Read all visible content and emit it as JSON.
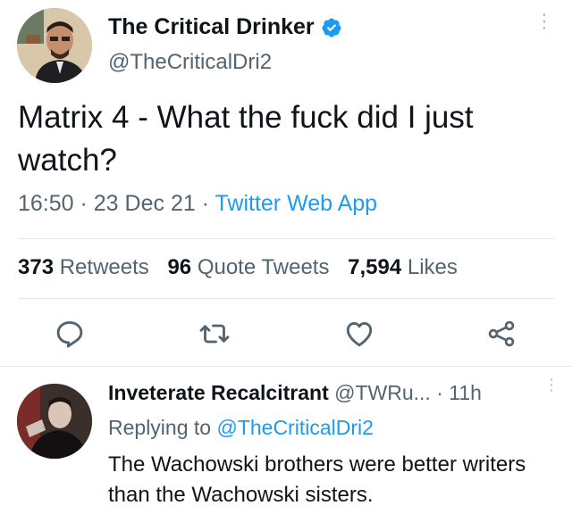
{
  "tweet": {
    "author": {
      "display_name": "The Critical Drinker",
      "handle": "@TheCriticalDri2",
      "verified": true
    },
    "text": "Matrix 4 - What the fuck did I just watch?",
    "time": "16:50",
    "separator1": " · ",
    "date": "23 Dec 21",
    "separator2": " · ",
    "source": "Twitter Web App",
    "stats": [
      {
        "count": "373",
        "label": "Retweets"
      },
      {
        "count": "96",
        "label": "Quote Tweets"
      },
      {
        "count": "7,594",
        "label": "Likes"
      }
    ],
    "actions": [
      "reply-icon",
      "retweet-icon",
      "like-icon",
      "share-icon"
    ]
  },
  "reply": {
    "display_name": "Inveterate Recalcitrant",
    "handle": "@TWRu...",
    "separator": " · ",
    "time": "11h",
    "replying_prefix": "Replying to ",
    "replying_to": "@TheCriticalDri2",
    "text": "The Wachowski brothers were better writers than the Wachowski sisters."
  },
  "colors": {
    "accent": "#1d9bf0",
    "secondary_text": "#536471",
    "primary_text": "#0f1419",
    "icon": "#536471"
  }
}
